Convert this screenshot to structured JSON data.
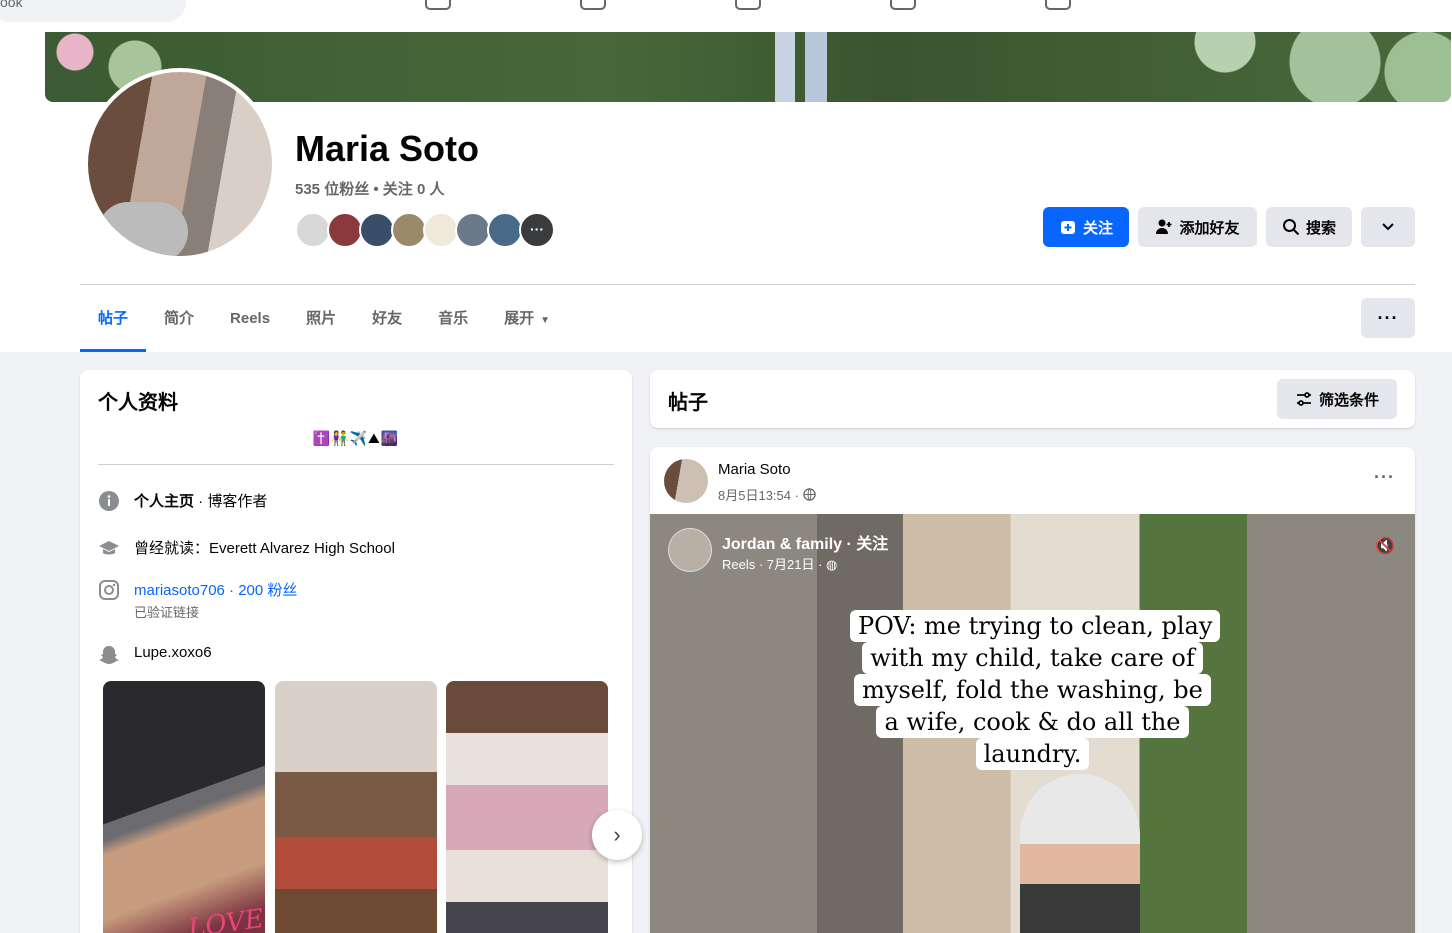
{
  "topnav": {
    "search_placeholder_fragment": "ook"
  },
  "profile": {
    "name": "Maria Soto",
    "followers_line": "535 位粉丝 • 关注 0 人",
    "more_friends_glyph": "···"
  },
  "actions": {
    "follow": "关注",
    "add_friend": "添加好友",
    "search": "搜索"
  },
  "tabs": [
    {
      "label": "帖子",
      "active": true
    },
    {
      "label": "简介"
    },
    {
      "label": "Reels"
    },
    {
      "label": "照片"
    },
    {
      "label": "好友"
    },
    {
      "label": "音乐"
    },
    {
      "label": "展开"
    }
  ],
  "intro": {
    "title": "个人资料",
    "emoji_bio": "✝️👫✈️⛰🌆",
    "page_prefix": "个人主页",
    "page_suffix": " · 博客作者",
    "school": "曾经就读：Everett Alvarez High School",
    "instagram": "mariasoto706 · 200 粉丝",
    "instagram_sub": "已验证链接",
    "snapchat": "Lupe.xoxo6",
    "photo1_text": "LOVE"
  },
  "posts": {
    "title": "帖子",
    "filter": "筛选条件",
    "post": {
      "author": "Maria Soto",
      "meta": "8月5日13:54 ·",
      "reel": {
        "source_name": "Jordan & family · 关注",
        "source_meta": "Reels · 7月21日 ·",
        "caption": "POV: me trying to clean, play with my child, take care of myself, fold the washing, be a wife, cook & do all the laundry."
      }
    }
  },
  "colors": {
    "accent": "#0866ff",
    "secondary_button": "#e4e6eb",
    "page_bg": "#f0f2f5"
  }
}
